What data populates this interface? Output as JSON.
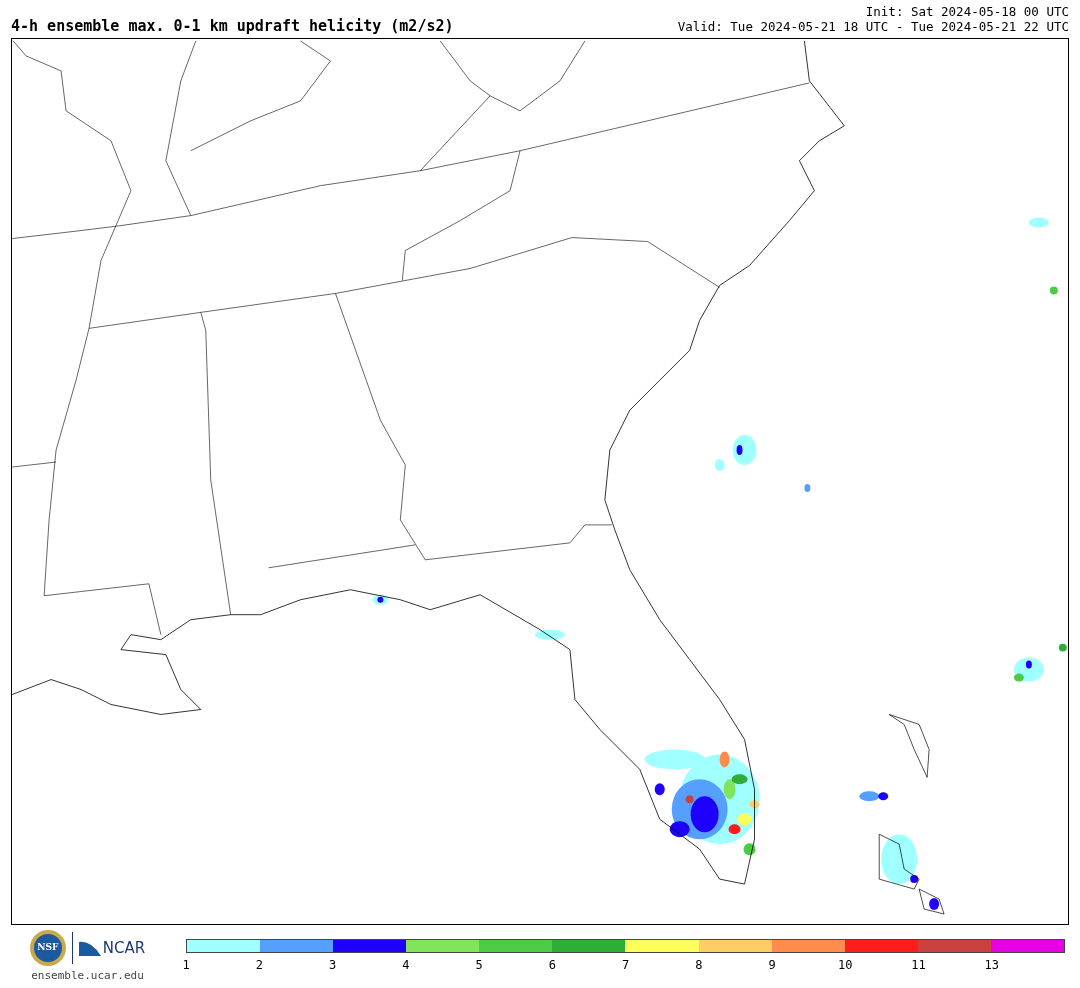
{
  "header": {
    "title": "4-h ensemble max. 0-1 km updraft helicity (m2/s2)",
    "init": "Init: Sat 2024-05-18 00 UTC",
    "valid": "Valid: Tue 2024-05-21 18 UTC - Tue 2024-05-21 22 UTC"
  },
  "footer": {
    "website": "ensemble.ucar.edu",
    "logo_text": "NCAR",
    "seal_text": "NSF"
  },
  "legend": {
    "bins": [
      {
        "label": "1",
        "color": "#a0ffff"
      },
      {
        "label": "2",
        "color": "#55a0ff"
      },
      {
        "label": "3",
        "color": "#1e00ff"
      },
      {
        "label": "4",
        "color": "#80e55a"
      },
      {
        "label": "5",
        "color": "#4ecb44"
      },
      {
        "label": "6",
        "color": "#2fae37"
      },
      {
        "label": "7",
        "color": "#ffff5a"
      },
      {
        "label": "8",
        "color": "#ffcc66"
      },
      {
        "label": "9",
        "color": "#ff8c4c"
      },
      {
        "label": "10",
        "color": "#ff1c1c"
      },
      {
        "label": "11",
        "color": "#cc4040"
      },
      {
        "label": "13",
        "color": "#e600e6"
      }
    ]
  }
}
